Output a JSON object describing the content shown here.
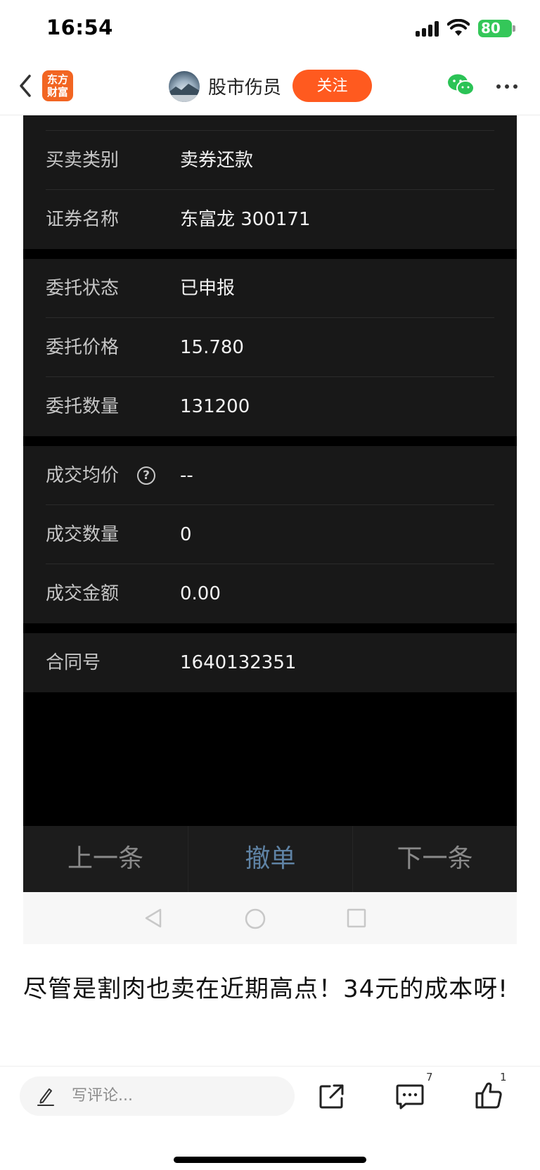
{
  "status_bar": {
    "time": "16:54",
    "battery": "80"
  },
  "nav": {
    "logo_text_line1": "东方",
    "logo_text_line2": "财富",
    "author": "股市伤员",
    "follow_label": "关注",
    "icons": [
      "back-arrow-icon",
      "wechat-icon",
      "more-icon"
    ]
  },
  "order_detail": {
    "groups": [
      {
        "rows": [
          {
            "label": "买卖类别",
            "value": "卖券还款"
          },
          {
            "label": "证券名称",
            "value": "东富龙 300171"
          }
        ]
      },
      {
        "rows": [
          {
            "label": "委托状态",
            "value": "已申报"
          },
          {
            "label": "委托价格",
            "value": "15.780"
          },
          {
            "label": "委托数量",
            "value": "131200"
          }
        ]
      },
      {
        "rows": [
          {
            "label": "成交均价",
            "value": "--"
          },
          {
            "label": "成交数量",
            "value": "0"
          },
          {
            "label": "成交金额",
            "value": "0.00"
          }
        ]
      },
      {
        "rows": [
          {
            "label": "合同号",
            "value": "1640132351"
          }
        ]
      }
    ],
    "help_glyph": "?",
    "actions": {
      "prev": "上一条",
      "cancel": "撤单",
      "next": "下一条"
    }
  },
  "post": {
    "text": "尽管是割肉也卖在近期高点！34元的成本呀!"
  },
  "bottom_bar": {
    "comment_placeholder": "写评论...",
    "comment_count": "7",
    "like_count": "1"
  },
  "colors": {
    "brand_orange": "#ff5a1f",
    "panel_bg": "#181818",
    "cancel_blue": "#5f83a5"
  }
}
